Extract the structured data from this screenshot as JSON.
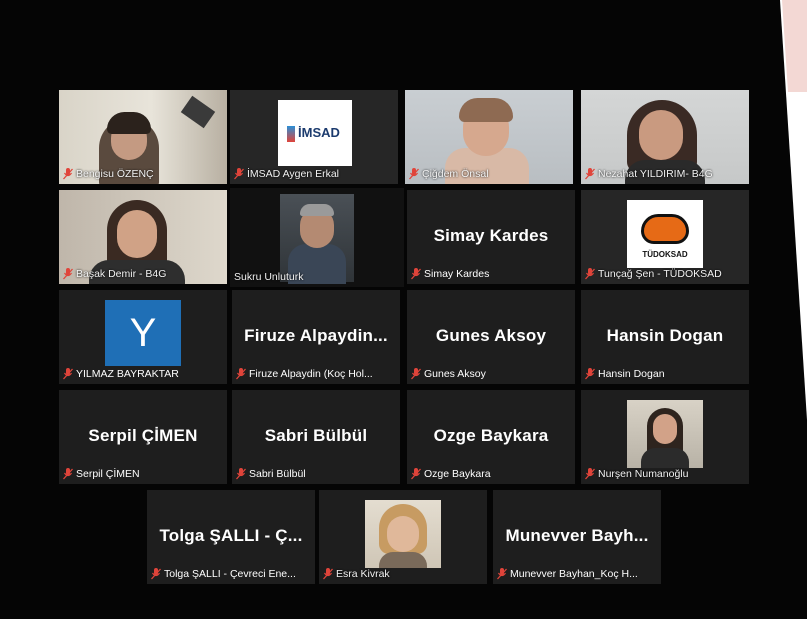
{
  "corner_text": "",
  "participants": [
    {
      "name": "Bengisu ÖZENÇ",
      "muted": true
    },
    {
      "name": "İMSAD Aygen Erkal",
      "muted": true,
      "logo_text": "İMSAD"
    },
    {
      "name": "Çiğdem Önsal",
      "muted": true
    },
    {
      "name": "Nezahat YILDIRIM- B4G",
      "muted": true
    },
    {
      "name": "Başak Demir - B4G",
      "muted": true
    },
    {
      "name": "Sukru Unluturk",
      "muted": false,
      "active_speaker": true
    },
    {
      "name": "Simay Kardes",
      "display": "Simay Kardes",
      "muted": true
    },
    {
      "name": "Tunçağ Şen - TÜDOKSAD",
      "muted": true,
      "logo_text": "TÜDOKSAD"
    },
    {
      "name": "YILMAZ BAYRAKTAR",
      "muted": true,
      "avatar_letter": "Y"
    },
    {
      "name": "Firuze Alpaydin (Koç Hol...",
      "display": "Firuze Alpaydin...",
      "muted": true
    },
    {
      "name": "Gunes Aksoy",
      "display": "Gunes Aksoy",
      "muted": true
    },
    {
      "name": "Hansin Dogan",
      "display": "Hansin Dogan",
      "muted": true
    },
    {
      "name": "Serpil ÇİMEN",
      "display": "Serpil ÇİMEN",
      "muted": true
    },
    {
      "name": "Sabri Bülbül",
      "display": "Sabri Bülbül",
      "muted": true
    },
    {
      "name": "Ozge Baykara",
      "display": "Ozge Baykara",
      "muted": true
    },
    {
      "name": "Nurşen Numanoğlu",
      "muted": true
    },
    {
      "name": "Tolga ŞALLI - Çevreci Ene...",
      "display": "Tolga ŞALLI - Ç...",
      "muted": true
    },
    {
      "name": "Esra Kivrak",
      "muted": true
    },
    {
      "name": "Munevver Bayhan_Koç H...",
      "display": "Munevver Bayh...",
      "muted": true
    }
  ],
  "colors": {
    "background": "#050505",
    "tile": "#1e1e1e",
    "active_outline": "#cde28a",
    "muted_icon": "#e0443a",
    "avatar_blue": "#1f6fb6"
  }
}
